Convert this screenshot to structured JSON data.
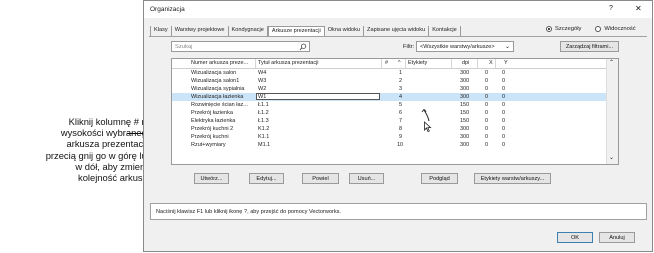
{
  "callout": {
    "lines": [
      "Kliknij kolumnę # na",
      "wysokości wybranego",
      "arkusza prezentacji i",
      "przecią gnij go w górę lub",
      "w dół, aby zmienić",
      "kolejność arkuszy"
    ]
  },
  "dialog": {
    "title": "Organizacja",
    "help": "?",
    "close": "✕",
    "tabs": [
      {
        "label": "Klasy"
      },
      {
        "label": "Warstwy projektowe"
      },
      {
        "label": "Kondygnacje"
      },
      {
        "label": "Arkusze prezentacji"
      },
      {
        "label": "Okna widoku"
      },
      {
        "label": "Zapisane ujęcia widoku"
      },
      {
        "label": "Kontakcje"
      }
    ],
    "active_tab": "Arkusze prezentacji",
    "view_mode": {
      "detailed": "Szczegóły",
      "thumbnails": "Widoczność",
      "selected": "Szczegóły"
    },
    "search": {
      "placeholder": "Szukaj"
    },
    "filter": {
      "label": "Filtr:",
      "value": "<Wszystkie warstwy/arkusze>"
    },
    "manage_filters": "Zarządzaj filtrami...",
    "table": {
      "headers": [
        "Numer arkusza preze...",
        "Tytuł arkusza prezentacji",
        "#",
        "^",
        "Etykiety",
        "dpi",
        "X",
        "Y"
      ],
      "rows": [
        {
          "number": "Wizualizacja salon",
          "title": "W4",
          "order": "1",
          "dpi": "300",
          "x": "0",
          "y": "0",
          "selected": false
        },
        {
          "number": "Wizualizacja salon1",
          "title": "W3",
          "order": "2",
          "dpi": "300",
          "x": "0",
          "y": "0",
          "selected": false
        },
        {
          "number": "Wizualizacja sypialnia",
          "title": "W2",
          "order": "3",
          "dpi": "300",
          "x": "0",
          "y": "0",
          "selected": false
        },
        {
          "number": "Wizualizacja łazienka",
          "title": "W1",
          "order": "4",
          "dpi": "300",
          "x": "0",
          "y": "0",
          "selected": true
        },
        {
          "number": "Rozwinięcie ścian łaz...",
          "title": "Ł1.1",
          "order": "5",
          "dpi": "150",
          "x": "0",
          "y": "0",
          "selected": false
        },
        {
          "number": "Przekrój łazienka",
          "title": "Ł1.2",
          "order": "6",
          "dpi": "150",
          "x": "0",
          "y": "0",
          "selected": false
        },
        {
          "number": "Elektryka łazienka",
          "title": "Ł1.3",
          "order": "7",
          "dpi": "150",
          "x": "0",
          "y": "0",
          "selected": false
        },
        {
          "number": "Przekrój kuchni 2",
          "title": "K1.2",
          "order": "8",
          "dpi": "300",
          "x": "0",
          "y": "0",
          "selected": false
        },
        {
          "number": "Przekrój kuchni",
          "title": "K1.1",
          "order": "9",
          "dpi": "300",
          "x": "0",
          "y": "0",
          "selected": false
        },
        {
          "number": "Rzut+wymiary",
          "title": "M1.1",
          "order": "10",
          "dpi": "300",
          "x": "0",
          "y": "0",
          "selected": false
        }
      ]
    },
    "buttons": {
      "new": "Utwórz...",
      "edit": "Edytuj...",
      "duplicate": "Powiel",
      "delete": "Usuń...",
      "preview": "Podgląd",
      "labels": "Etykiety warstw/arkuszy..."
    },
    "status": "Naciśnij klawisz F1 lub kliknij ikonę ?, aby przejść do pomocy Vectorworks.",
    "ok": "OK",
    "cancel": "Anuluj"
  }
}
